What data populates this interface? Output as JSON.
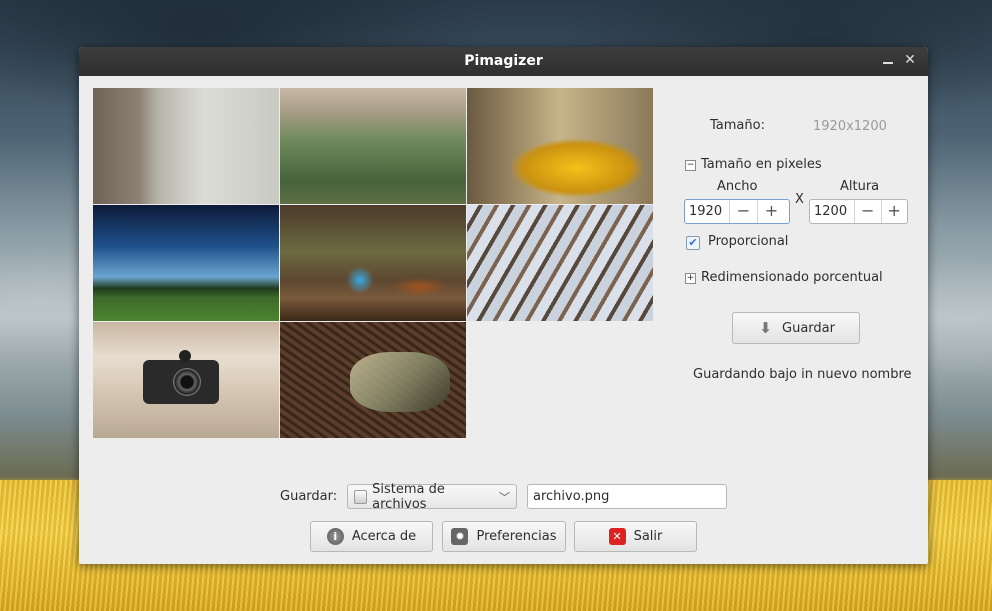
{
  "window": {
    "title": "Pimagizer"
  },
  "icons": {
    "minimize": "minimize-icon",
    "close": "close-icon",
    "download": "download-icon",
    "info": "info-icon",
    "gear": "gear-icon",
    "quit": "quit-icon"
  },
  "size": {
    "label": "Tamaño:",
    "value": "1920x1200"
  },
  "pixels": {
    "section_label": "Tamaño en pixeles",
    "width_label": "Ancho",
    "height_label": "Altura",
    "separator": "X",
    "width_value": "1920",
    "height_value": "1200",
    "minus": "−",
    "plus": "+",
    "proportional_label": "Proporcional",
    "proportional_checked": true
  },
  "percent": {
    "section_label": "Redimensionado porcentual"
  },
  "save": {
    "button_label": "Guardar",
    "status": "Guardando bajo in nuevo nombre"
  },
  "bottom": {
    "save_label": "Guardar:",
    "destination": "Sistema de archivos",
    "filename": "archivo.png",
    "about_label": "Acerca de",
    "prefs_label": "Preferencias",
    "quit_label": "Salir"
  }
}
